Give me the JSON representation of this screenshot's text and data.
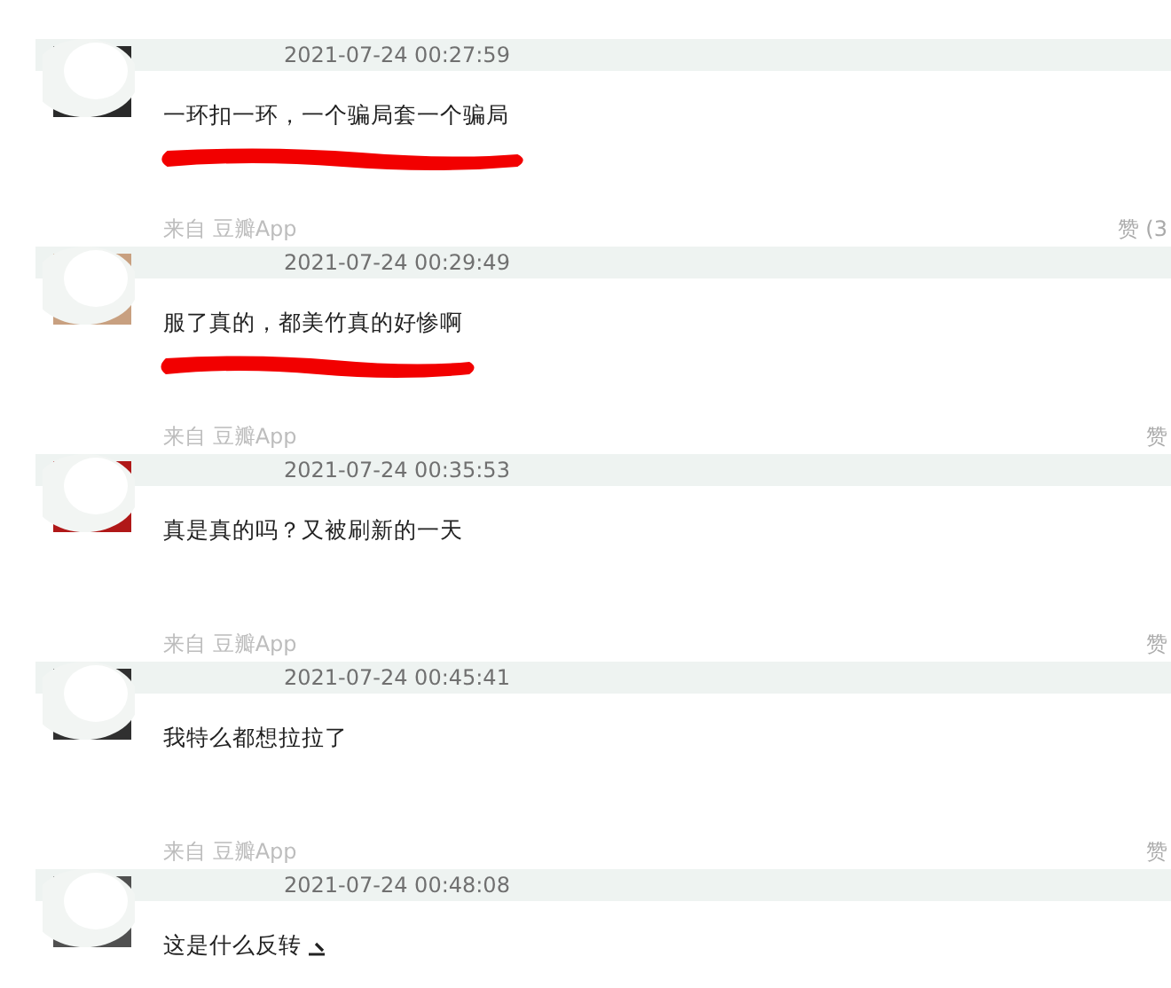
{
  "comments": [
    {
      "time": "2021-07-24 00:27:59",
      "text": "一环扣一环，一个骗局套一个骗局",
      "redacted": true,
      "source": "来自 豆瓣App",
      "like": "赞 (3",
      "emoji": false
    },
    {
      "time": "2021-07-24 00:29:49",
      "text": "服了真的，都美竹真的好惨啊",
      "redacted": true,
      "source": "来自 豆瓣App",
      "like": "赞",
      "emoji": false
    },
    {
      "time": "2021-07-24 00:35:53",
      "text": "真是真的吗？又被刷新的一天",
      "redacted": false,
      "source": "来自 豆瓣App",
      "like": "赞",
      "emoji": false
    },
    {
      "time": "2021-07-24 00:45:41",
      "text": "我特么都想拉拉了",
      "redacted": false,
      "source": "来自 豆瓣App",
      "like": "赞",
      "emoji": false
    },
    {
      "time": "2021-07-24 00:48:08",
      "text": "这是什么反转",
      "redacted": false,
      "emoji": true
    }
  ]
}
